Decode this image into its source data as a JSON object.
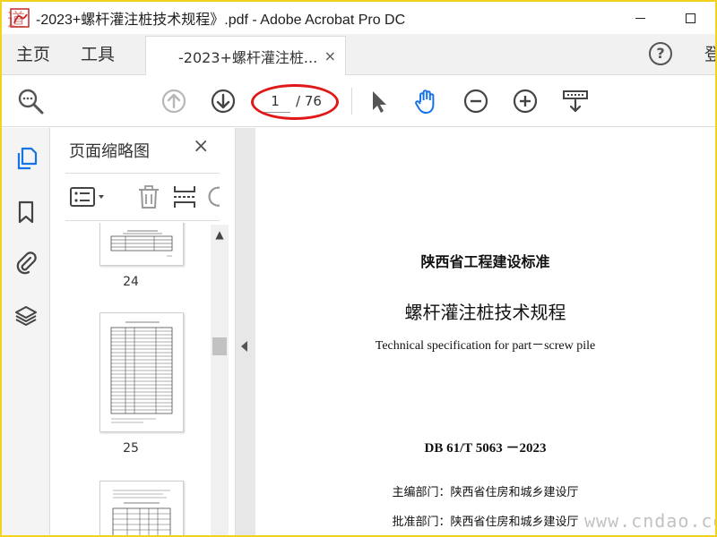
{
  "window": {
    "title": "-2023+螺杆灌注桩技术规程》.pdf - Adobe Acrobat Pro DC",
    "watermark_top_left": "道",
    "watermark_bottom_right": "www.cndao.com"
  },
  "nav": {
    "home": "主页",
    "tools": "工具",
    "login_partial": "登"
  },
  "doc_tab": {
    "label": "-2023+螺杆灌注桩...",
    "close": "×"
  },
  "help": {
    "label": "?"
  },
  "toolbar": {
    "page_current": "1",
    "page_total": "/ 76"
  },
  "thumb_panel": {
    "title": "页面缩略图",
    "close": "×",
    "pages": [
      {
        "number": "24"
      },
      {
        "number": "25"
      }
    ]
  },
  "scrollbar": {
    "up_arrow": "▲"
  },
  "document": {
    "header_cn": "陕西省工程建设标准",
    "title_cn": "螺杆灌注桩技术规程",
    "title_en": "Technical specification for part－screw pile",
    "code": "DB 61/T  5063 －2023",
    "editor_dept": "主编部门：陕西省住房和城乡建设厅",
    "approval_dept": "批准部门：陕西省住房和城乡建设厅"
  },
  "colors": {
    "frame_border": "#f2d21c",
    "accent_blue": "#1473e6",
    "annotation_red": "#e01818"
  }
}
